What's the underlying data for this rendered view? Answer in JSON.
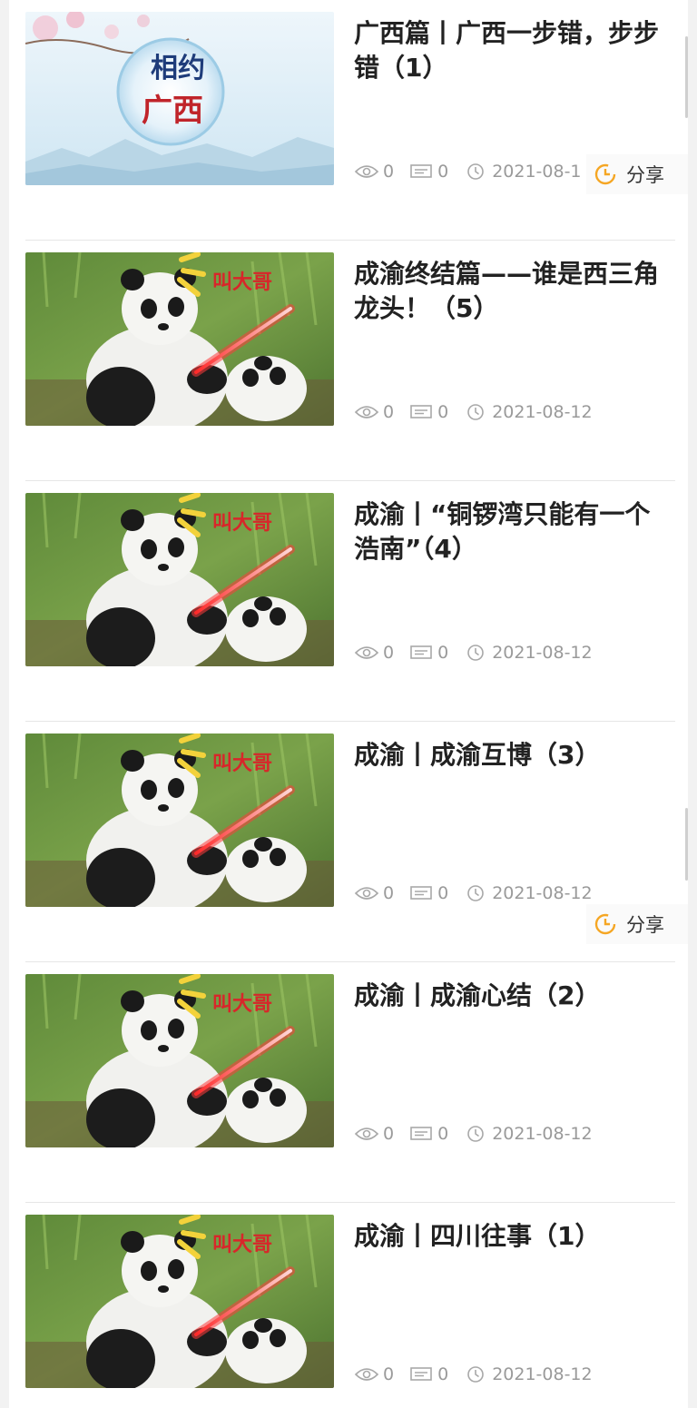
{
  "articles": [
    {
      "title": "广西篇丨广西一步错，步步错（1）",
      "views": "0",
      "comments": "0",
      "date": "2021-08-1",
      "thumb": "guangxi",
      "thumb_text": "相约广西"
    },
    {
      "title": "成渝终结篇——谁是西三角龙头！（5）",
      "views": "0",
      "comments": "0",
      "date": "2021-08-12",
      "thumb": "panda",
      "thumb_text": "叫大哥"
    },
    {
      "title": "成渝丨“铜锣湾只能有一个浩南”（4）",
      "views": "0",
      "comments": "0",
      "date": "2021-08-12",
      "thumb": "panda",
      "thumb_text": "叫大哥"
    },
    {
      "title": "成渝丨成渝互博（3）",
      "views": "0",
      "comments": "0",
      "date": "2021-08-12",
      "thumb": "panda",
      "thumb_text": "叫大哥"
    },
    {
      "title": "成渝丨成渝心结（2）",
      "views": "0",
      "comments": "0",
      "date": "2021-08-12",
      "thumb": "panda",
      "thumb_text": "叫大哥"
    },
    {
      "title": "成渝丨四川往事（1）",
      "views": "0",
      "comments": "0",
      "date": "2021-08-12",
      "thumb": "panda",
      "thumb_text": "叫大哥"
    }
  ],
  "share": {
    "label": "分享"
  },
  "colors": {
    "accent": "#f5a623",
    "meta": "#9a9a9a",
    "title": "#222222"
  }
}
